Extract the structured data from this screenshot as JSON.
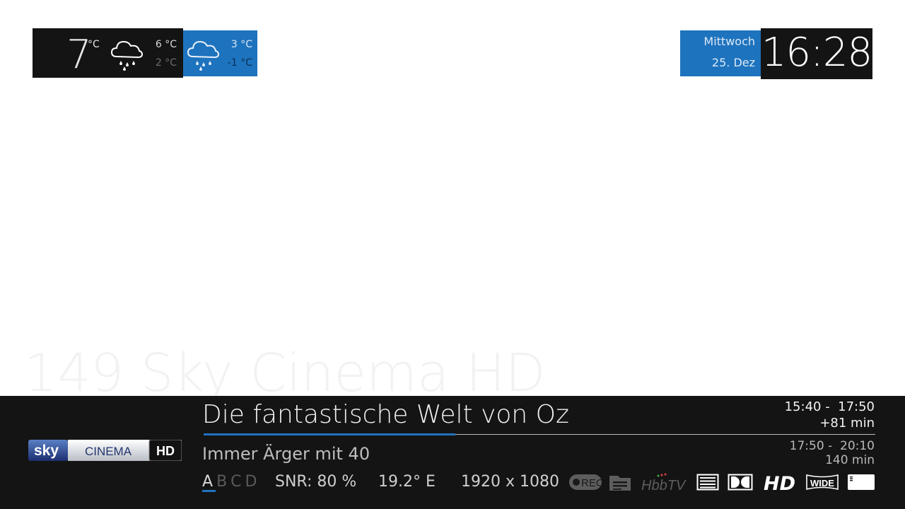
{
  "weather": {
    "today": {
      "temp": "7",
      "unit": "°C",
      "icon": "rain-cloud-icon",
      "high": "6 °C",
      "low": "2 °C"
    },
    "tomorrow": {
      "icon": "rain-cloud-icon",
      "high": "3 °C",
      "low": "-1 °C"
    }
  },
  "clock": {
    "weekday": "Mittwoch",
    "date": "25. Dez",
    "time": "16:28"
  },
  "channel": {
    "name": "149 Sky Cinema HD",
    "logo_text": [
      "sky",
      "CINEMA",
      "HD"
    ]
  },
  "now": {
    "title": "Die fantastische Welt von Oz",
    "time_range": "15:40 -  17:50",
    "remaining": "+81 min",
    "progress": 0.375
  },
  "next": {
    "title": "Immer Ärger mit 40",
    "time_range": "17:50 -  20:10",
    "duration": "140 min"
  },
  "tech": {
    "audio_tracks": [
      "A",
      "B",
      "C",
      "D"
    ],
    "active_track": "A",
    "snr": "SNR:  80 %",
    "orbital": "19.2° E",
    "resolution": "1920 x 1080",
    "icons": [
      "rec-icon",
      "epg-icon",
      "hbbtv-icon",
      "teletext-icon",
      "dolby-icon",
      "hd-icon",
      "wide-icon",
      "subtitle-icon"
    ],
    "icon_labels": {
      "rec": "REC",
      "hbbtv": "HbbTV",
      "hd": "HD",
      "wide": "WIDE"
    }
  },
  "colors": {
    "accent": "#1e73be",
    "panel": "#141414",
    "text": "#f2f2f2",
    "muted": "#6e6e6e"
  }
}
